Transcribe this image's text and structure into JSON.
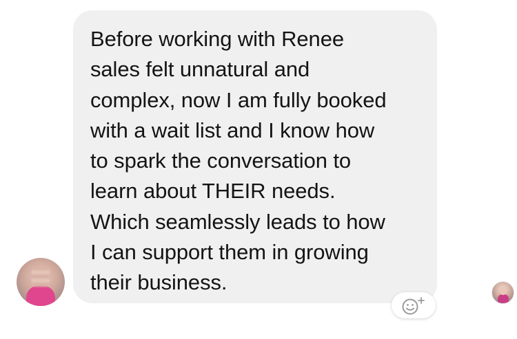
{
  "message": {
    "lines": [
      "Before working with Renee",
      "sales felt unnatural and",
      "complex, now I am fully booked",
      "with a wait list and I know how",
      "to spark the conversation to",
      "learn about THEIR needs.",
      "Which seamlessly leads to how",
      "I can support them in growing",
      "their business."
    ]
  },
  "icons": {
    "reaction": "smiley-plus-icon",
    "sender_avatar": "avatar",
    "read_receipt": "read-receipt-avatar"
  },
  "colors": {
    "bubble": "#f0f0f0",
    "text": "#141414",
    "background": "#ffffff"
  }
}
